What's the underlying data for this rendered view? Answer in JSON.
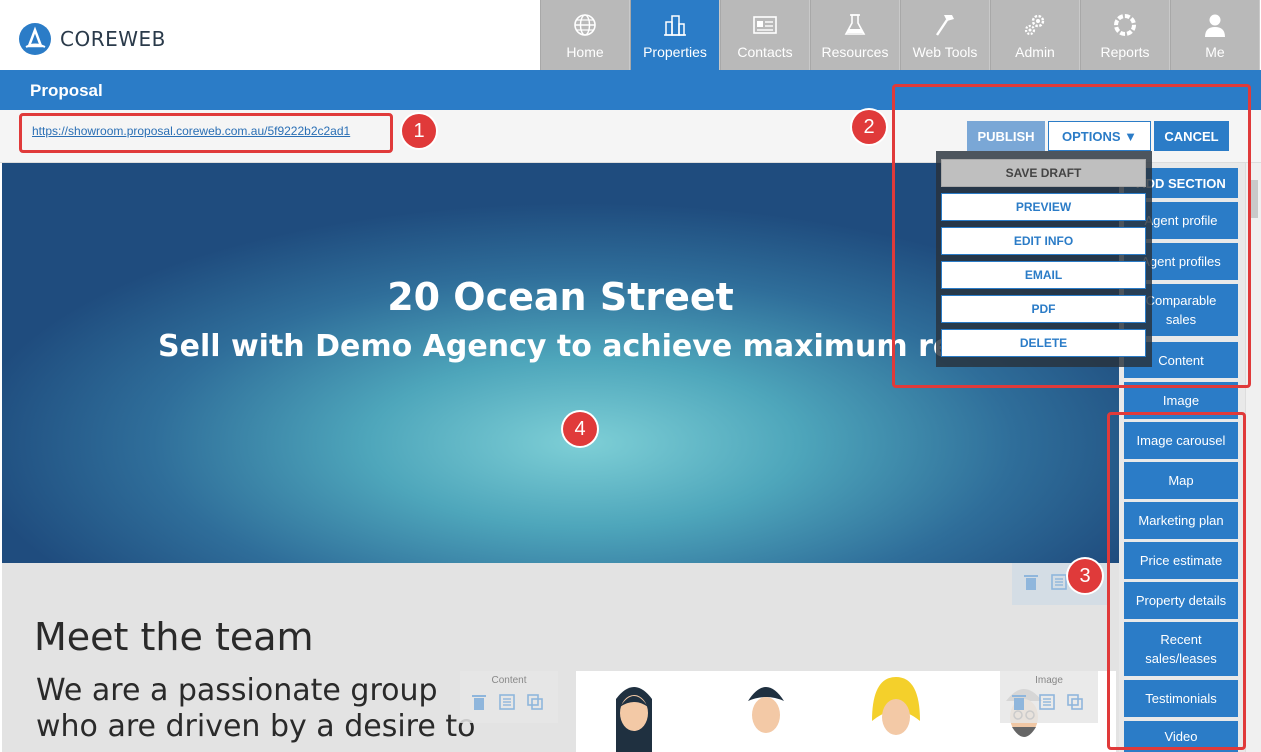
{
  "app": {
    "logo_text": "COREWEB"
  },
  "nav": [
    {
      "label": "Home",
      "icon": "globe-icon",
      "active": false
    },
    {
      "label": "Properties",
      "icon": "buildings-icon",
      "active": true
    },
    {
      "label": "Contacts",
      "icon": "contact-card-icon",
      "active": false
    },
    {
      "label": "Resources",
      "icon": "flask-icon",
      "active": false
    },
    {
      "label": "Web Tools",
      "icon": "hammer-icon",
      "active": false
    },
    {
      "label": "Admin",
      "icon": "gears-icon",
      "active": false
    },
    {
      "label": "Reports",
      "icon": "ring-icon",
      "active": false
    },
    {
      "label": "Me",
      "icon": "user-icon",
      "active": false
    }
  ],
  "page": {
    "title": "Proposal"
  },
  "urlbar": {
    "url": "https://showroom.proposal.coreweb.com.au/5f9222b2c2ad1",
    "publish": "PUBLISH",
    "options": "OPTIONS ▼",
    "cancel": "CANCEL"
  },
  "options_menu": [
    "SAVE DRAFT",
    "PREVIEW",
    "EDIT INFO",
    "EMAIL",
    "PDF",
    "DELETE"
  ],
  "hero": {
    "title": "20 Ocean Street",
    "subtitle": "Sell with Demo Agency to achieve maximum results"
  },
  "content": {
    "heading": "Meet the team",
    "body": "We are a passionate group who are driven by a desire to",
    "toolbox_content_label": "Content",
    "toolbox_image_label": "Image"
  },
  "sidebar": {
    "header": "ADD SECTION",
    "items": [
      "Agent profile",
      "Agent profiles",
      "Comparable sales",
      "Content",
      "Image",
      "Image carousel",
      "Map",
      "Marketing plan",
      "Price estimate",
      "Property details",
      "Recent sales/leases",
      "Testimonials",
      "Video"
    ]
  },
  "annotations": [
    "1",
    "2",
    "3",
    "4"
  ],
  "colors": {
    "brand_blue": "#2b7cc7",
    "nav_gray": "#b9b9b9",
    "annotation_red": "#e03a3a"
  }
}
